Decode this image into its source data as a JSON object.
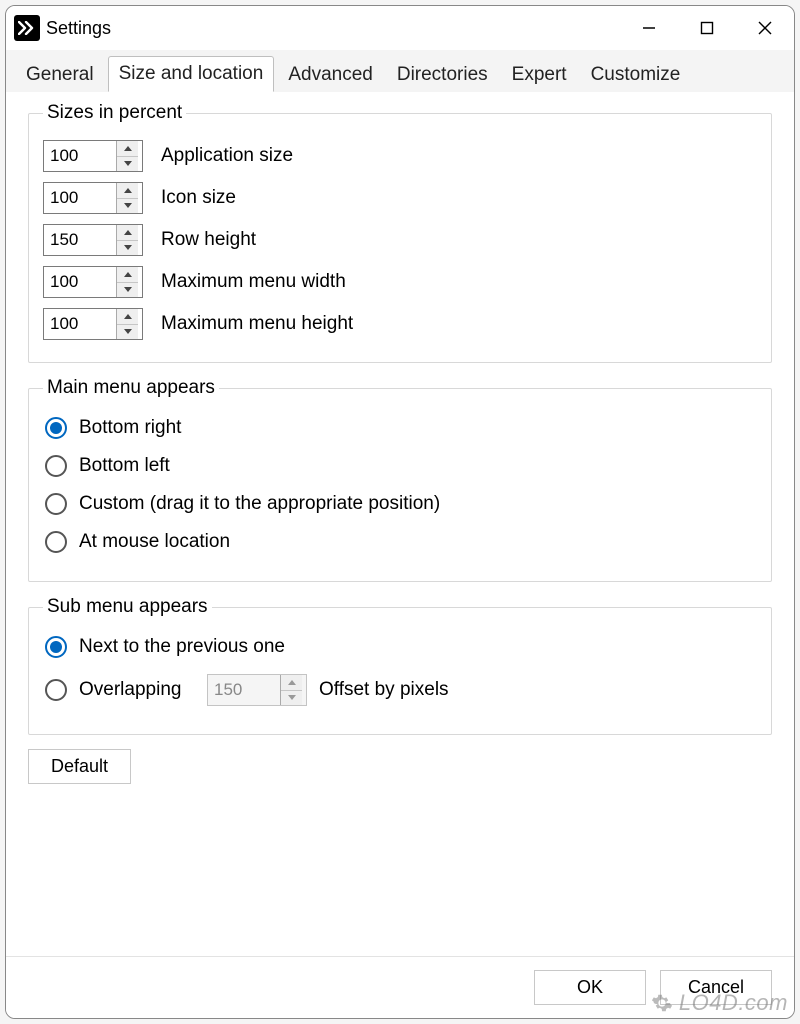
{
  "window": {
    "title": "Settings"
  },
  "tabs": {
    "general": "General",
    "size_location": "Size and location",
    "advanced": "Advanced",
    "directories": "Directories",
    "expert": "Expert",
    "customize": "Customize"
  },
  "groups": {
    "sizes": {
      "legend": "Sizes in percent",
      "app_size": {
        "value": "100",
        "label": "Application size"
      },
      "icon_size": {
        "value": "100",
        "label": "Icon size"
      },
      "row_height": {
        "value": "150",
        "label": "Row height"
      },
      "max_menu_width": {
        "value": "100",
        "label": "Maximum menu width"
      },
      "max_menu_height": {
        "value": "100",
        "label": "Maximum menu height"
      }
    },
    "main_menu": {
      "legend": "Main menu appears",
      "bottom_right": "Bottom right",
      "bottom_left": "Bottom left",
      "custom": "Custom (drag it to the appropriate position)",
      "at_mouse": "At mouse location"
    },
    "sub_menu": {
      "legend": "Sub menu appears",
      "next_to": "Next to the previous one",
      "overlapping": "Overlapping",
      "offset_value": "150",
      "offset_label": "Offset by pixels"
    }
  },
  "buttons": {
    "default": "Default",
    "ok": "OK",
    "cancel": "Cancel"
  },
  "watermark": "LO4D.com"
}
